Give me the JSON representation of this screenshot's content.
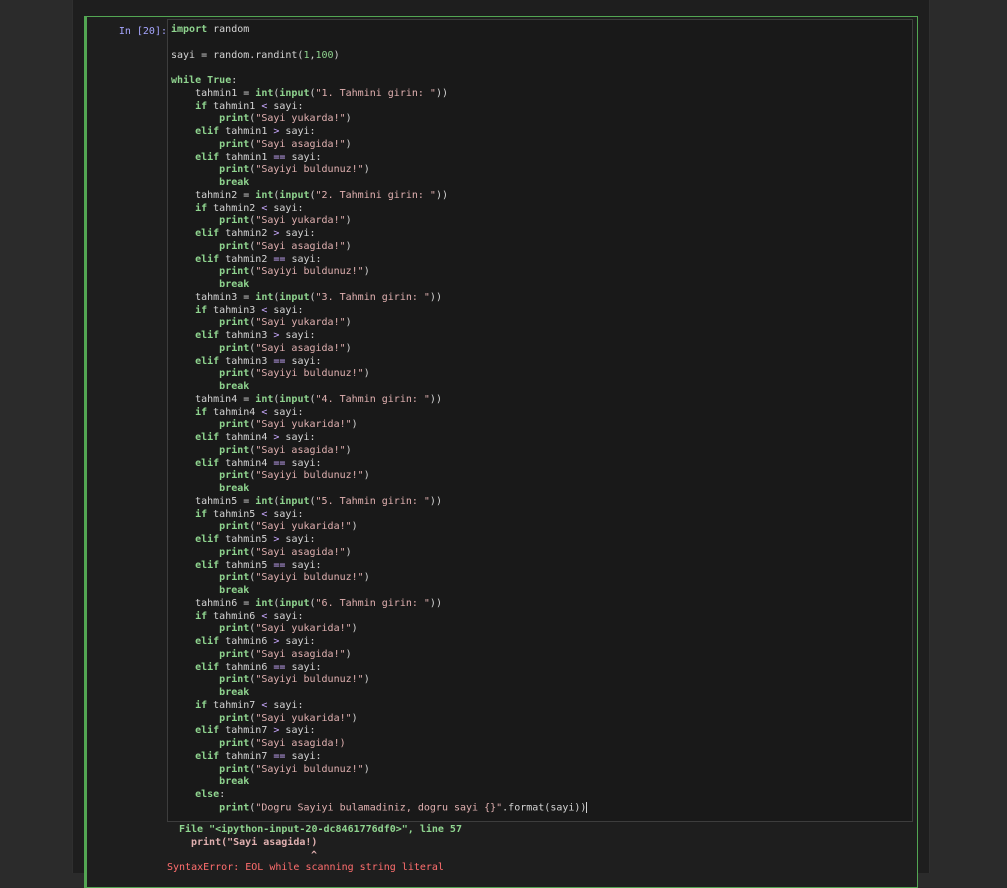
{
  "cell": {
    "prompt": "In [20]:"
  },
  "code_lines": [
    [
      [
        "kw",
        "import"
      ],
      [
        "t",
        " random"
      ]
    ],
    [],
    [
      [
        "t",
        "sayi = random.randint("
      ],
      [
        "nu",
        "1"
      ],
      [
        "t",
        ","
      ],
      [
        "nu",
        "100"
      ],
      [
        "t",
        ")"
      ]
    ],
    [],
    [
      [
        "kw",
        "while"
      ],
      [
        "t",
        " "
      ],
      [
        "kw",
        "True"
      ],
      [
        "t",
        ":"
      ]
    ],
    [
      [
        "t",
        "    tahmin1 = "
      ],
      [
        "kw",
        "int"
      ],
      [
        "t",
        "("
      ],
      [
        "kw",
        "input"
      ],
      [
        "t",
        "("
      ],
      [
        "st",
        "\"1. Tahmini girin: \""
      ],
      [
        "t",
        "))"
      ]
    ],
    [
      [
        "t",
        "    "
      ],
      [
        "kw",
        "if"
      ],
      [
        "t",
        " tahmin1 "
      ],
      [
        "op",
        "<"
      ],
      [
        "t",
        " sayi:"
      ]
    ],
    [
      [
        "t",
        "        "
      ],
      [
        "kw",
        "print"
      ],
      [
        "t",
        "("
      ],
      [
        "st",
        "\"Sayi yukarda!\""
      ],
      [
        "t",
        ")"
      ]
    ],
    [
      [
        "t",
        "    "
      ],
      [
        "kw",
        "elif"
      ],
      [
        "t",
        " tahmin1 "
      ],
      [
        "op",
        ">"
      ],
      [
        "t",
        " sayi:"
      ]
    ],
    [
      [
        "t",
        "        "
      ],
      [
        "kw",
        "print"
      ],
      [
        "t",
        "("
      ],
      [
        "st",
        "\"Sayi asagida!\""
      ],
      [
        "t",
        ")"
      ]
    ],
    [
      [
        "t",
        "    "
      ],
      [
        "kw",
        "elif"
      ],
      [
        "t",
        " tahmin1 "
      ],
      [
        "op",
        "=="
      ],
      [
        "t",
        " sayi:"
      ]
    ],
    [
      [
        "t",
        "        "
      ],
      [
        "kw",
        "print"
      ],
      [
        "t",
        "("
      ],
      [
        "st",
        "\"Sayiyi buldunuz!\""
      ],
      [
        "t",
        ")"
      ]
    ],
    [
      [
        "t",
        "        "
      ],
      [
        "kw",
        "break"
      ]
    ],
    [
      [
        "t",
        "    tahmin2 = "
      ],
      [
        "kw",
        "int"
      ],
      [
        "t",
        "("
      ],
      [
        "kw",
        "input"
      ],
      [
        "t",
        "("
      ],
      [
        "st",
        "\"2. Tahmini girin: \""
      ],
      [
        "t",
        "))"
      ]
    ],
    [
      [
        "t",
        "    "
      ],
      [
        "kw",
        "if"
      ],
      [
        "t",
        " tahmin2 "
      ],
      [
        "op",
        "<"
      ],
      [
        "t",
        " sayi:"
      ]
    ],
    [
      [
        "t",
        "        "
      ],
      [
        "kw",
        "print"
      ],
      [
        "t",
        "("
      ],
      [
        "st",
        "\"Sayi yukarda!\""
      ],
      [
        "t",
        ")"
      ]
    ],
    [
      [
        "t",
        "    "
      ],
      [
        "kw",
        "elif"
      ],
      [
        "t",
        " tahmin2 "
      ],
      [
        "op",
        ">"
      ],
      [
        "t",
        " sayi:"
      ]
    ],
    [
      [
        "t",
        "        "
      ],
      [
        "kw",
        "print"
      ],
      [
        "t",
        "("
      ],
      [
        "st",
        "\"Sayi asagida!\""
      ],
      [
        "t",
        ")"
      ]
    ],
    [
      [
        "t",
        "    "
      ],
      [
        "kw",
        "elif"
      ],
      [
        "t",
        " tahmin2 "
      ],
      [
        "op",
        "=="
      ],
      [
        "t",
        " sayi:"
      ]
    ],
    [
      [
        "t",
        "        "
      ],
      [
        "kw",
        "print"
      ],
      [
        "t",
        "("
      ],
      [
        "st",
        "\"Sayiyi buldunuz!\""
      ],
      [
        "t",
        ")"
      ]
    ],
    [
      [
        "t",
        "        "
      ],
      [
        "kw",
        "break"
      ]
    ],
    [
      [
        "t",
        "    tahmin3 = "
      ],
      [
        "kw",
        "int"
      ],
      [
        "t",
        "("
      ],
      [
        "kw",
        "input"
      ],
      [
        "t",
        "("
      ],
      [
        "st",
        "\"3. Tahmin girin: \""
      ],
      [
        "t",
        "))"
      ]
    ],
    [
      [
        "t",
        "    "
      ],
      [
        "kw",
        "if"
      ],
      [
        "t",
        " tahmin3 "
      ],
      [
        "op",
        "<"
      ],
      [
        "t",
        " sayi:"
      ]
    ],
    [
      [
        "t",
        "        "
      ],
      [
        "kw",
        "print"
      ],
      [
        "t",
        "("
      ],
      [
        "st",
        "\"Sayi yukarda!\""
      ],
      [
        "t",
        ")"
      ]
    ],
    [
      [
        "t",
        "    "
      ],
      [
        "kw",
        "elif"
      ],
      [
        "t",
        " tahmin3 "
      ],
      [
        "op",
        ">"
      ],
      [
        "t",
        " sayi:"
      ]
    ],
    [
      [
        "t",
        "        "
      ],
      [
        "kw",
        "print"
      ],
      [
        "t",
        "("
      ],
      [
        "st",
        "\"Sayi asagida!\""
      ],
      [
        "t",
        ")"
      ]
    ],
    [
      [
        "t",
        "    "
      ],
      [
        "kw",
        "elif"
      ],
      [
        "t",
        " tahmin3 "
      ],
      [
        "op",
        "=="
      ],
      [
        "t",
        " sayi:"
      ]
    ],
    [
      [
        "t",
        "        "
      ],
      [
        "kw",
        "print"
      ],
      [
        "t",
        "("
      ],
      [
        "st",
        "\"Sayiyi buldunuz!\""
      ],
      [
        "t",
        ")"
      ]
    ],
    [
      [
        "t",
        "        "
      ],
      [
        "kw",
        "break"
      ]
    ],
    [
      [
        "t",
        "    tahmin4 = "
      ],
      [
        "kw",
        "int"
      ],
      [
        "t",
        "("
      ],
      [
        "kw",
        "input"
      ],
      [
        "t",
        "("
      ],
      [
        "st",
        "\"4. Tahmin girin: \""
      ],
      [
        "t",
        "))"
      ]
    ],
    [
      [
        "t",
        "    "
      ],
      [
        "kw",
        "if"
      ],
      [
        "t",
        " tahmin4 "
      ],
      [
        "op",
        "<"
      ],
      [
        "t",
        " sayi:"
      ]
    ],
    [
      [
        "t",
        "        "
      ],
      [
        "kw",
        "print"
      ],
      [
        "t",
        "("
      ],
      [
        "st",
        "\"Sayi yukarida!\""
      ],
      [
        "t",
        ")"
      ]
    ],
    [
      [
        "t",
        "    "
      ],
      [
        "kw",
        "elif"
      ],
      [
        "t",
        " tahmin4 "
      ],
      [
        "op",
        ">"
      ],
      [
        "t",
        " sayi:"
      ]
    ],
    [
      [
        "t",
        "        "
      ],
      [
        "kw",
        "print"
      ],
      [
        "t",
        "("
      ],
      [
        "st",
        "\"Sayi asagida!\""
      ],
      [
        "t",
        ")"
      ]
    ],
    [
      [
        "t",
        "    "
      ],
      [
        "kw",
        "elif"
      ],
      [
        "t",
        " tahmin4 "
      ],
      [
        "op",
        "=="
      ],
      [
        "t",
        " sayi:"
      ]
    ],
    [
      [
        "t",
        "        "
      ],
      [
        "kw",
        "print"
      ],
      [
        "t",
        "("
      ],
      [
        "st",
        "\"Sayiyi buldunuz!\""
      ],
      [
        "t",
        ")"
      ]
    ],
    [
      [
        "t",
        "        "
      ],
      [
        "kw",
        "break"
      ]
    ],
    [
      [
        "t",
        "    tahmin5 = "
      ],
      [
        "kw",
        "int"
      ],
      [
        "t",
        "("
      ],
      [
        "kw",
        "input"
      ],
      [
        "t",
        "("
      ],
      [
        "st",
        "\"5. Tahmin girin: \""
      ],
      [
        "t",
        "))"
      ]
    ],
    [
      [
        "t",
        "    "
      ],
      [
        "kw",
        "if"
      ],
      [
        "t",
        " tahmin5 "
      ],
      [
        "op",
        "<"
      ],
      [
        "t",
        " sayi:"
      ]
    ],
    [
      [
        "t",
        "        "
      ],
      [
        "kw",
        "print"
      ],
      [
        "t",
        "("
      ],
      [
        "st",
        "\"Sayi yukarida!\""
      ],
      [
        "t",
        ")"
      ]
    ],
    [
      [
        "t",
        "    "
      ],
      [
        "kw",
        "elif"
      ],
      [
        "t",
        " tahmin5 "
      ],
      [
        "op",
        ">"
      ],
      [
        "t",
        " sayi:"
      ]
    ],
    [
      [
        "t",
        "        "
      ],
      [
        "kw",
        "print"
      ],
      [
        "t",
        "("
      ],
      [
        "st",
        "\"Sayi asagida!\""
      ],
      [
        "t",
        ")"
      ]
    ],
    [
      [
        "t",
        "    "
      ],
      [
        "kw",
        "elif"
      ],
      [
        "t",
        " tahmin5 "
      ],
      [
        "op",
        "=="
      ],
      [
        "t",
        " sayi:"
      ]
    ],
    [
      [
        "t",
        "        "
      ],
      [
        "kw",
        "print"
      ],
      [
        "t",
        "("
      ],
      [
        "st",
        "\"Sayiyi buldunuz!\""
      ],
      [
        "t",
        ")"
      ]
    ],
    [
      [
        "t",
        "        "
      ],
      [
        "kw",
        "break"
      ]
    ],
    [
      [
        "t",
        "    tahmin6 = "
      ],
      [
        "kw",
        "int"
      ],
      [
        "t",
        "("
      ],
      [
        "kw",
        "input"
      ],
      [
        "t",
        "("
      ],
      [
        "st",
        "\"6. Tahmin girin: \""
      ],
      [
        "t",
        "))"
      ]
    ],
    [
      [
        "t",
        "    "
      ],
      [
        "kw",
        "if"
      ],
      [
        "t",
        " tahmin6 "
      ],
      [
        "op",
        "<"
      ],
      [
        "t",
        " sayi:"
      ]
    ],
    [
      [
        "t",
        "        "
      ],
      [
        "kw",
        "print"
      ],
      [
        "t",
        "("
      ],
      [
        "st",
        "\"Sayi yukarida!\""
      ],
      [
        "t",
        ")"
      ]
    ],
    [
      [
        "t",
        "    "
      ],
      [
        "kw",
        "elif"
      ],
      [
        "t",
        " tahmin6 "
      ],
      [
        "op",
        ">"
      ],
      [
        "t",
        " sayi:"
      ]
    ],
    [
      [
        "t",
        "        "
      ],
      [
        "kw",
        "print"
      ],
      [
        "t",
        "("
      ],
      [
        "st",
        "\"Sayi asagida!\""
      ],
      [
        "t",
        ")"
      ]
    ],
    [
      [
        "t",
        "    "
      ],
      [
        "kw",
        "elif"
      ],
      [
        "t",
        " tahmin6 "
      ],
      [
        "op",
        "=="
      ],
      [
        "t",
        " sayi:"
      ]
    ],
    [
      [
        "t",
        "        "
      ],
      [
        "kw",
        "print"
      ],
      [
        "t",
        "("
      ],
      [
        "st",
        "\"Sayiyi buldunuz!\""
      ],
      [
        "t",
        ")"
      ]
    ],
    [
      [
        "t",
        "        "
      ],
      [
        "kw",
        "break"
      ]
    ],
    [
      [
        "t",
        "    "
      ],
      [
        "kw",
        "if"
      ],
      [
        "t",
        " tahmin7 "
      ],
      [
        "op",
        "<"
      ],
      [
        "t",
        " sayi:"
      ]
    ],
    [
      [
        "t",
        "        "
      ],
      [
        "kw",
        "print"
      ],
      [
        "t",
        "("
      ],
      [
        "st",
        "\"Sayi yukarida!\""
      ],
      [
        "t",
        ")"
      ]
    ],
    [
      [
        "t",
        "    "
      ],
      [
        "kw",
        "elif"
      ],
      [
        "t",
        " tahmin7 "
      ],
      [
        "op",
        ">"
      ],
      [
        "t",
        " sayi:"
      ]
    ],
    [
      [
        "t",
        "        "
      ],
      [
        "kw",
        "print"
      ],
      [
        "t",
        "("
      ],
      [
        "st",
        "\"Sayi asagida!)"
      ]
    ],
    [
      [
        "t",
        "    "
      ],
      [
        "kw",
        "elif"
      ],
      [
        "t",
        " tahmin7 "
      ],
      [
        "op",
        "=="
      ],
      [
        "t",
        " sayi:"
      ]
    ],
    [
      [
        "t",
        "        "
      ],
      [
        "kw",
        "print"
      ],
      [
        "t",
        "("
      ],
      [
        "st",
        "\"Sayiyi buldunuz!\""
      ],
      [
        "t",
        ")"
      ]
    ],
    [
      [
        "t",
        "        "
      ],
      [
        "kw",
        "break"
      ]
    ],
    [
      [
        "t",
        "    "
      ],
      [
        "kw",
        "else"
      ],
      [
        "t",
        ":"
      ]
    ],
    [
      [
        "t",
        "        "
      ],
      [
        "kw",
        "print"
      ],
      [
        "t",
        "("
      ],
      [
        "st",
        "\"Dogru Sayiyi bulamadiniz, dogru sayi {}\""
      ],
      [
        "t",
        ".format(sayi))"
      ]
    ]
  ],
  "output": {
    "file_line": "File \"<ipython-input-20-dc8461776df0>\", line 57",
    "code_line": "print(\"Sayi asagida!)",
    "caret": "^",
    "error_line": "SyntaxError: EOL while scanning string literal"
  },
  "colors": {
    "cell_border": "#53a653",
    "keyword": "#8fd48f",
    "string": "#e0b0b0",
    "prompt": "#a6a6ff",
    "error": "#ff6e6e"
  }
}
